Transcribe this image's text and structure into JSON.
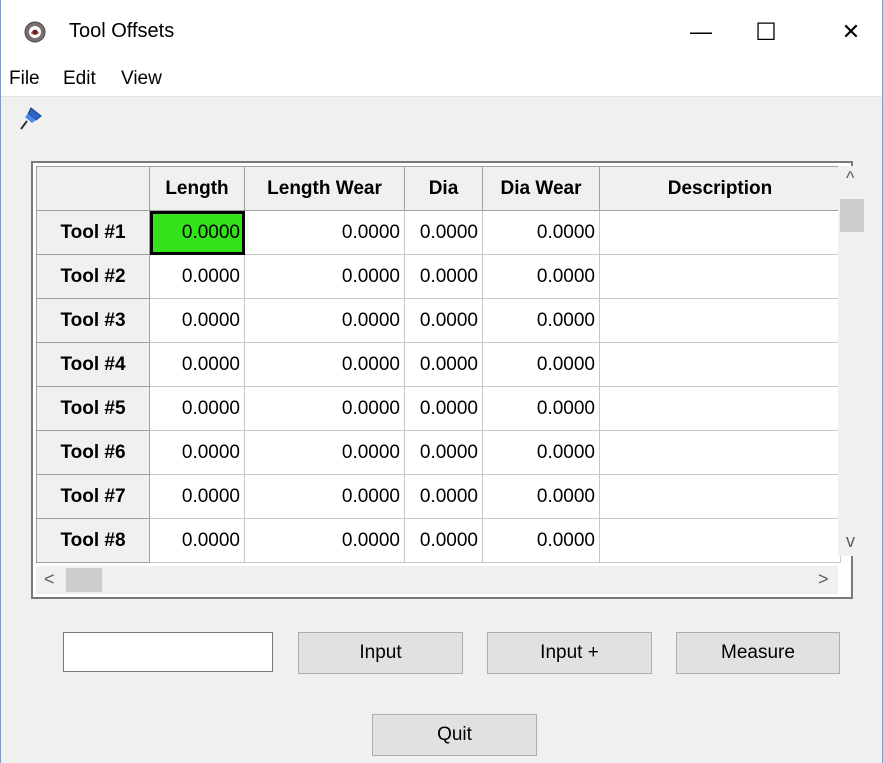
{
  "window": {
    "title": "Tool Offsets"
  },
  "titlebar": {
    "minimize_glyph": "—",
    "maximize_glyph": "☐",
    "close_glyph": "✕"
  },
  "menu": {
    "items": [
      "File",
      "Edit",
      "View"
    ]
  },
  "table": {
    "columns": [
      "Length",
      "Length Wear",
      "Dia",
      "Dia Wear",
      "Description"
    ],
    "rows": [
      {
        "label": "Tool #1",
        "values": [
          "0.0000",
          "0.0000",
          "0.0000",
          "0.0000",
          ""
        ]
      },
      {
        "label": "Tool #2",
        "values": [
          "0.0000",
          "0.0000",
          "0.0000",
          "0.0000",
          ""
        ]
      },
      {
        "label": "Tool #3",
        "values": [
          "0.0000",
          "0.0000",
          "0.0000",
          "0.0000",
          ""
        ]
      },
      {
        "label": "Tool #4",
        "values": [
          "0.0000",
          "0.0000",
          "0.0000",
          "0.0000",
          ""
        ]
      },
      {
        "label": "Tool #5",
        "values": [
          "0.0000",
          "0.0000",
          "0.0000",
          "0.0000",
          ""
        ]
      },
      {
        "label": "Tool #6",
        "values": [
          "0.0000",
          "0.0000",
          "0.0000",
          "0.0000",
          ""
        ]
      },
      {
        "label": "Tool #7",
        "values": [
          "0.0000",
          "0.0000",
          "0.0000",
          "0.0000",
          ""
        ]
      },
      {
        "label": "Tool #8",
        "values": [
          "0.0000",
          "0.0000",
          "0.0000",
          "0.0000",
          ""
        ]
      }
    ],
    "selected_color": "#33e21a"
  },
  "scroll": {
    "up": "^",
    "down": "v",
    "left": "<",
    "right": ">"
  },
  "input": {
    "value": ""
  },
  "buttons": {
    "input": "Input",
    "input_plus": "Input +",
    "measure": "Measure",
    "quit": "Quit"
  },
  "icons": {
    "app": "app-logo-icon",
    "pin": "pushpin-icon"
  }
}
